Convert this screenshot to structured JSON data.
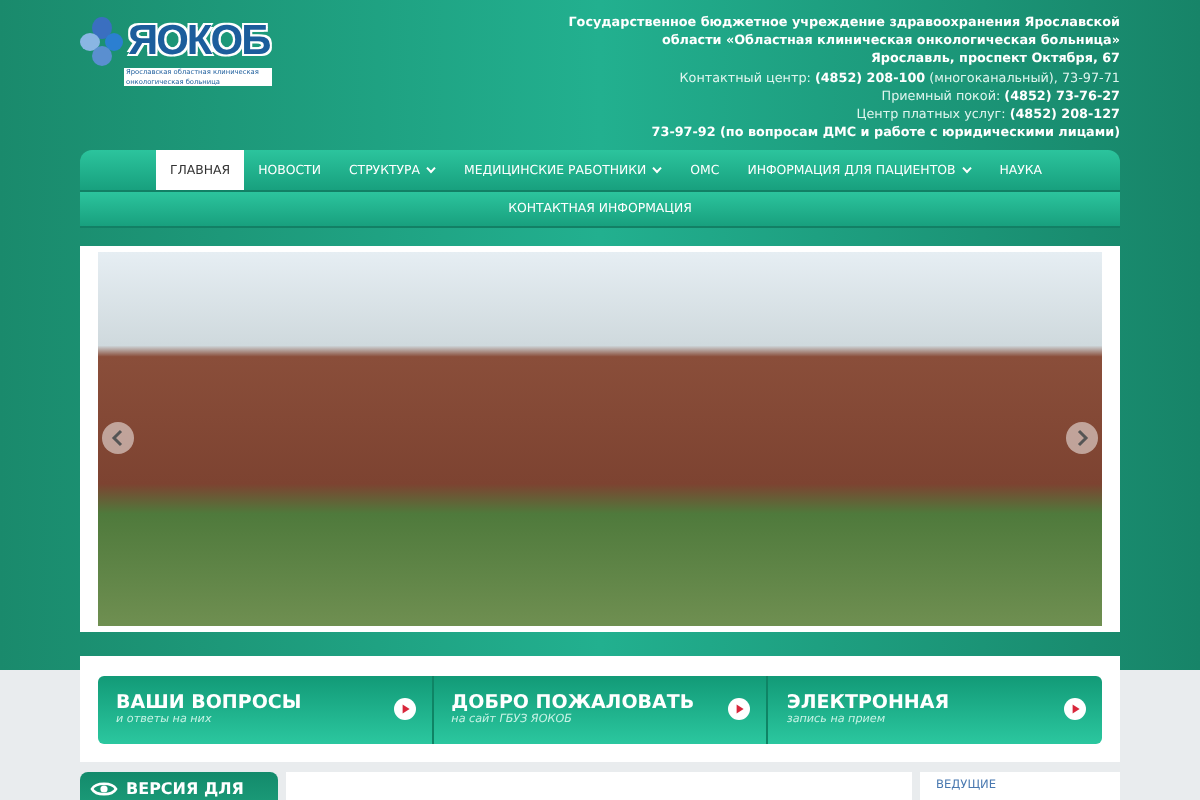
{
  "logo": {
    "name": "ЯОКОБ",
    "subtitle": "Ярославская областная клиническая онкологическая больница"
  },
  "header_info": [
    {
      "text": "Государственное бюджетное учреждение здравоохранения Ярославской",
      "bold": true
    },
    {
      "text": "области «Областная клиническая онкологическая больница»",
      "bold": true
    },
    {
      "text": "Ярославль, проспект Октября, 67",
      "bold": true
    },
    {
      "text": "Контактный центр: **(4852) 208-100** (многоканальный), 73-97-71",
      "bold": false
    },
    {
      "text": "Приемный покой: **(4852) 73-76-27**",
      "bold": false
    },
    {
      "text": "Центр платных услуг: **(4852) 208-127**",
      "bold": false
    },
    {
      "text": "73-97-92 (по вопросам ДМС и работе с юридическими лицами)",
      "bold": true
    }
  ],
  "nav": {
    "items": [
      {
        "label": "ГЛАВНАЯ",
        "selected": true,
        "dropdown": false
      },
      {
        "label": "НОВОСТИ",
        "selected": false,
        "dropdown": false
      },
      {
        "label": "СТРУКТУРА",
        "selected": false,
        "dropdown": true
      },
      {
        "label": "МЕДИЦИНСКИЕ РАБОТНИКИ",
        "selected": false,
        "dropdown": true
      },
      {
        "label": "ОМС",
        "selected": false,
        "dropdown": false
      },
      {
        "label": "ИНФОРМАЦИЯ ДЛЯ ПАЦИЕНТОВ",
        "selected": false,
        "dropdown": true
      },
      {
        "label": "НАУКА",
        "selected": false,
        "dropdown": false
      }
    ]
  },
  "nav_second_row": {
    "items": [
      {
        "label": "КОНТАКТНАЯ ИНФОРМАЦИЯ",
        "selected": false,
        "dropdown": false
      }
    ]
  },
  "promo_buttons": [
    {
      "title": "ВАШИ ВОПРОСЫ",
      "subtitle": "и ответы на них"
    },
    {
      "title": "ДОБРО ПОЖАЛОВАТЬ",
      "subtitle": "на сайт ГБУЗ ЯОКОБ"
    },
    {
      "title": "ЭЛЕКТРОННАЯ",
      "subtitle": "запись на прием"
    }
  ],
  "accessibility_card": {
    "title": "ВЕРСИЯ ДЛЯ"
  },
  "specialists_card": {
    "title": "ВЕДУЩИЕ"
  }
}
